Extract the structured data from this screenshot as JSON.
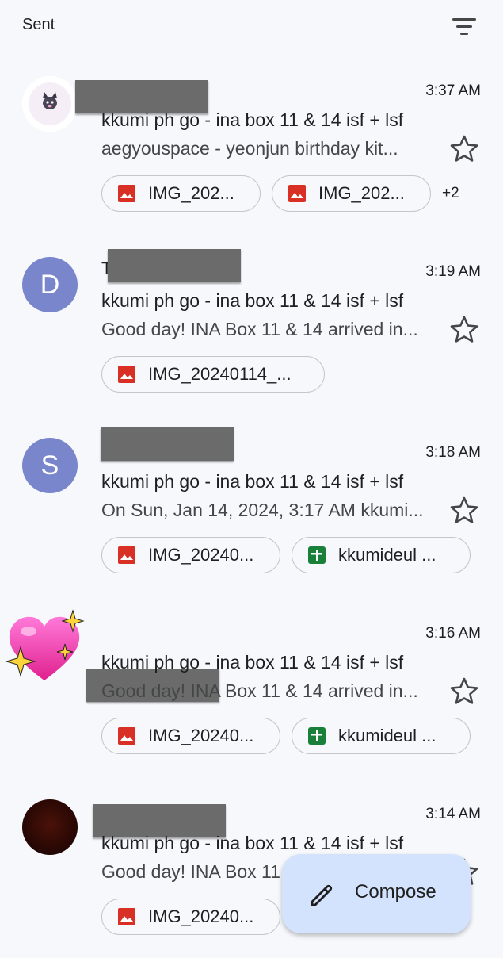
{
  "header": {
    "title": "Sent",
    "filter_icon": "filter-list-icon"
  },
  "colors": {
    "background": "#f6f8fc",
    "avatar_purple": "#7986cb",
    "image_icon_red": "#d93025",
    "sheets_green": "#188038",
    "compose_bg": "#d3e3fd"
  },
  "emails": [
    {
      "time": "3:37 AM",
      "subject": "kkumi ph go - ina box 11 & 14 isf + lsf",
      "snippet": "aegyouspace - yeonjun birthday kit...",
      "attachments": [
        {
          "icon": "image-icon",
          "label": "IMG_202..."
        },
        {
          "icon": "image-icon",
          "label": "IMG_202..."
        }
      ],
      "more_attachments": "+2"
    },
    {
      "avatar_letter": "D",
      "sender_visible": "T",
      "time": "3:19 AM",
      "subject": "kkumi ph go - ina box 11 & 14 isf + lsf",
      "snippet": "Good day! INA Box 11 & 14 arrived in...",
      "attachments": [
        {
          "icon": "image-icon",
          "label": "IMG_20240114_..."
        }
      ]
    },
    {
      "avatar_letter": "S",
      "time": "3:18 AM",
      "subject": "kkumi ph go - ina box 11 & 14 isf + lsf",
      "snippet": "On Sun, Jan 14, 2024, 3:17 AM kkumi...",
      "attachments": [
        {
          "icon": "image-icon",
          "label": "IMG_20240..."
        },
        {
          "icon": "sheets-icon",
          "label": "kkumideul ..."
        }
      ]
    },
    {
      "time": "3:16 AM",
      "subject": "kkumi ph go - ina box 11 & 14 isf + lsf",
      "snippet": "Good day! INA Box 11 & 14 arrived in...",
      "attachments": [
        {
          "icon": "image-icon",
          "label": "IMG_20240..."
        },
        {
          "icon": "sheets-icon",
          "label": "kkumideul ..."
        }
      ]
    },
    {
      "time": "3:14 AM",
      "subject": "kkumi ph go - ina box 11 & 14 isf + lsf",
      "snippet": "Good day! INA Box 11 & 14 arrived in...",
      "attachments": [
        {
          "icon": "image-icon",
          "label": "IMG_20240..."
        }
      ]
    }
  ],
  "compose": {
    "label": "Compose",
    "icon": "pencil-icon"
  }
}
